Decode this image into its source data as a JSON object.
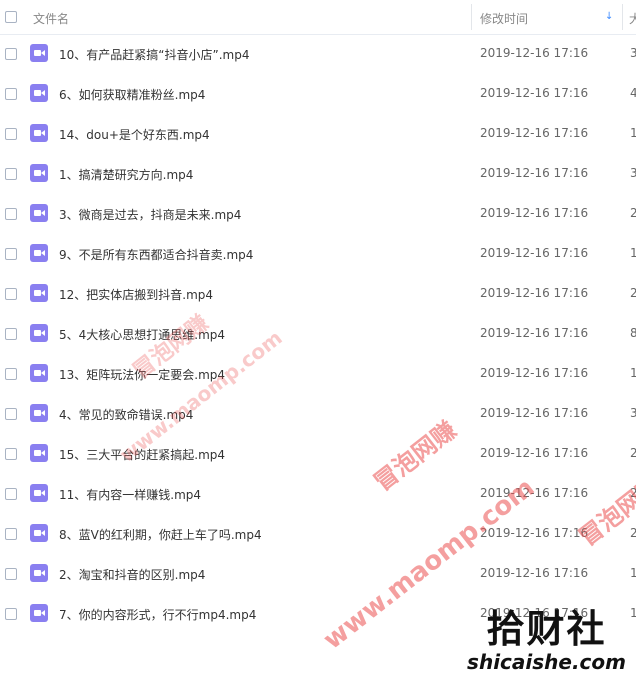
{
  "header": {
    "col_name": "文件名",
    "col_time": "修改时间",
    "col_size": "大",
    "sort_glyph": "↓"
  },
  "files": [
    {
      "name": "10、有产品赶紧搞“抖音小店”.mp4",
      "time": "2019-12-16 17:16",
      "size": "3"
    },
    {
      "name": "6、如何获取精准粉丝.mp4",
      "time": "2019-12-16 17:16",
      "size": "4"
    },
    {
      "name": "14、dou+是个好东西.mp4",
      "time": "2019-12-16 17:16",
      "size": "1"
    },
    {
      "name": "1、搞清楚研究方向.mp4",
      "time": "2019-12-16 17:16",
      "size": "3"
    },
    {
      "name": "3、微商是过去，抖商是未来.mp4",
      "time": "2019-12-16 17:16",
      "size": "2"
    },
    {
      "name": "9、不是所有东西都适合抖音卖.mp4",
      "time": "2019-12-16 17:16",
      "size": "1"
    },
    {
      "name": "12、把实体店搬到抖音.mp4",
      "time": "2019-12-16 17:16",
      "size": "2"
    },
    {
      "name": "5、4大核心思想打通思维.mp4",
      "time": "2019-12-16 17:16",
      "size": "8"
    },
    {
      "name": "13、矩阵玩法你一定要会.mp4",
      "time": "2019-12-16 17:16",
      "size": "1"
    },
    {
      "name": "4、常见的致命错误.mp4",
      "time": "2019-12-16 17:16",
      "size": "3"
    },
    {
      "name": "15、三大平台的赶紧搞起.mp4",
      "time": "2019-12-16 17:16",
      "size": "2"
    },
    {
      "name": "11、有内容一样赚钱.mp4",
      "time": "2019-12-16 17:16",
      "size": "2"
    },
    {
      "name": "8、蓝V的红利期，你赶上车了吗.mp4",
      "time": "2019-12-16 17:16",
      "size": "2"
    },
    {
      "name": "2、淘宝和抖音的区别.mp4",
      "time": "2019-12-16 17:16",
      "size": "1"
    },
    {
      "name": "7、你的内容形式，行不行mp4.mp4",
      "time": "2019-12-16 17:16",
      "size": "1"
    }
  ],
  "watermarks": {
    "cn": "冒泡网赚",
    "url": "www.maomp.com",
    "logo_cn": "拾财社",
    "logo_en": "shicaishe.com"
  },
  "icons": {
    "file": "video-file-icon",
    "sort": "sort-down-arrow-icon"
  },
  "colors": {
    "file_icon": "#8a7ff0",
    "sort_arrow": "#3f8cff",
    "watermark": "#eb5050"
  }
}
